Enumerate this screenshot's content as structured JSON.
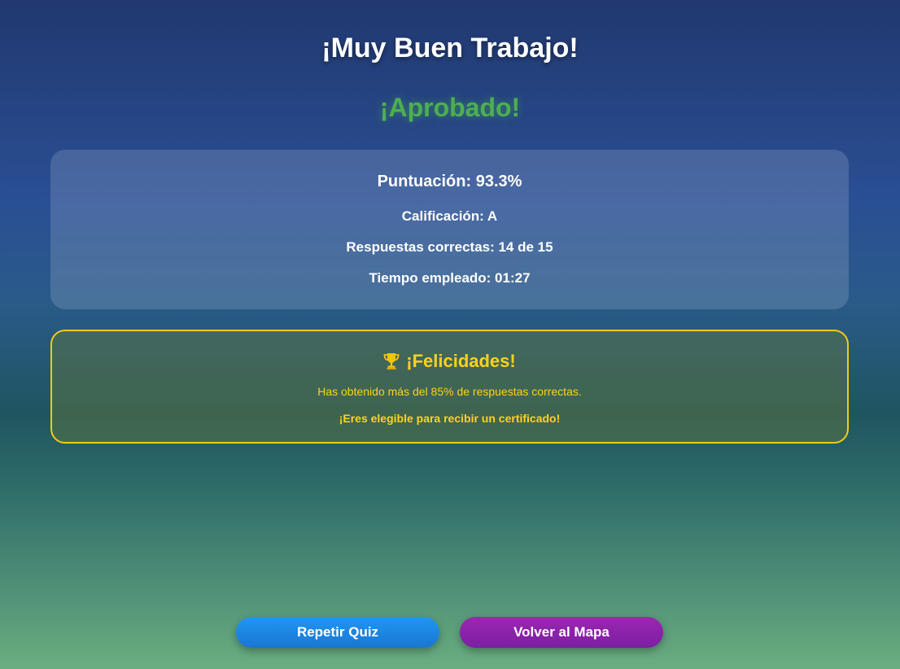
{
  "header": {
    "title": "¡Muy Buen Trabajo!",
    "status": "¡Aprobado!"
  },
  "results": {
    "score": "Puntuación: 93.3%",
    "grade": "Calificación: A",
    "correct": "Respuestas correctas: 14 de 15",
    "time": "Tiempo empleado: 01:27"
  },
  "congrats": {
    "icon": "trophy-icon",
    "title": "¡Felicidades!",
    "message": "Has obtenido más del 85% de respuestas correctas.",
    "certificate": "¡Eres elegible para recibir un certificado!"
  },
  "actions": {
    "repeat_label": "Repetir Quiz",
    "map_label": "Volver al Mapa"
  },
  "colors": {
    "status_green": "#4caf50",
    "congrats_gold": "#ffd21a",
    "repeat_blue": "#2196f3",
    "map_purple": "#9c27b0"
  }
}
